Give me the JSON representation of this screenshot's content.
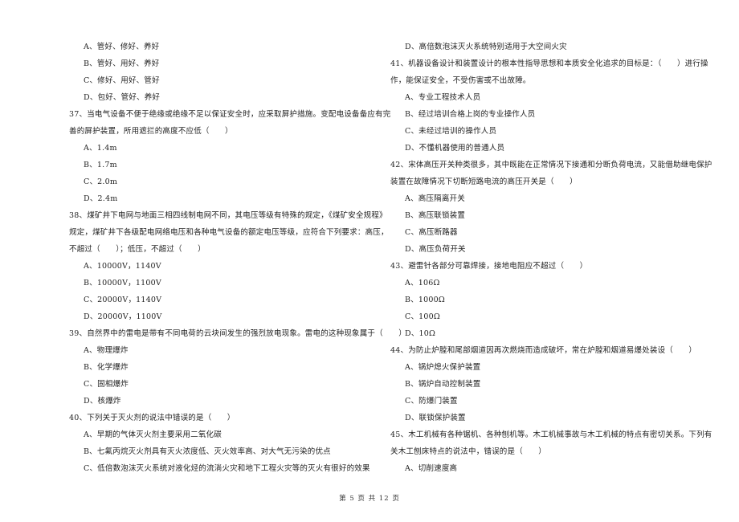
{
  "left_column": {
    "q36_options": [
      "A、管好、修好、养好",
      "B、管好、用好、养好",
      "C、修好、用好、管好",
      "D、包好、管好、养好"
    ],
    "q37": {
      "stem_lines": [
        "37、当电气设备不便于绝缘或绝缘不足以保证安全时，应采取屏护措施。变配电设备备应有完",
        "善的屏护装置，所用遮拦的高度不应低（　　）"
      ],
      "options": [
        "A、1.4m",
        "B、1.7m",
        "C、2.0m",
        "D、2.4m"
      ]
    },
    "q38": {
      "stem_lines": [
        "38、煤矿井下电网与地面三相四线制电网不同，其电压等级有特殊的规定，《煤矿安全规程》",
        "规定，煤矿井下各级配电网络电压和各种电气设备的额定电压等级，应符合下列要求：高压，",
        "不超过（　　）；低压，不超过（　　）"
      ],
      "options": [
        "A、10000V，1140V",
        "B、10000V，1100V",
        "C、20000V，1140V",
        "D、20000V，1100V"
      ]
    },
    "q39": {
      "stem_lines": [
        "39、自然界中的雷电是带有不同电荷的云块间发生的强烈放电现象。雷电的这种现象属于（　　）"
      ],
      "options": [
        "A、物理爆炸",
        "B、化学爆炸",
        "C、固相爆炸",
        "D、核爆炸"
      ]
    },
    "q40": {
      "stem_lines": [
        "40、下列关于灭火剂的说法中错误的是（　　）"
      ],
      "options": [
        "A、早期的气体灭火剂主要采用二氧化碳",
        "B、七氟丙烷灭火剂具有灭火浓度低、灭火效率高、对大气无污染的优点",
        "C、低倍数泡沫灭火系统对液化烃的流淌火灾和地下工程火灾等的灭火有很好的效果"
      ]
    }
  },
  "right_column": {
    "q40_option_d": "D、高倍数泡沫灭火系统特别适用于大空间火灾",
    "q41": {
      "stem_lines": [
        "41、机器设备设计和装置设计的根本性指导思想和本质安全化追求的目标是：（　　）进行操",
        "作，能保证安全，不受伤害或不出故障。"
      ],
      "options": [
        "A、专业工程技术人员",
        "B、经过培训合格上岗的专业操作人员",
        "C、未经过培训的操作人员",
        "D、不懂机器使用的普通人员"
      ]
    },
    "q42": {
      "stem_lines": [
        "42、宋体高压开关种类很多，其中既能在正常情况下接通和分断负荷电流，又能借助继电保护",
        "装置在故障情况下切断短路电流的高压开关是（　　）"
      ],
      "options": [
        "A、高压隔离开关",
        "B、高压联锁装置",
        "C、高压断路器",
        "D、高压负荷开关"
      ]
    },
    "q43": {
      "stem_lines": [
        "43、避雷针各部分可靠焊接，接地电阻应不超过（　　）"
      ],
      "options": [
        "A、106Ω",
        "B、1000Ω",
        "C、100Ω",
        "D、10Ω"
      ]
    },
    "q44": {
      "stem_lines": [
        "44、为防止炉膛和尾部烟道因再次燃烧而造成破坏，常在炉膛和烟道易爆处装设（　　）"
      ],
      "options": [
        "A、锅炉熄火保护装置",
        "B、锅炉自动控制装置",
        "C、防爆门装置",
        "D、联锁保护装置"
      ]
    },
    "q45": {
      "stem_lines": [
        "45、木工机械有各种锯机、各种刨机等。木工机械事故与木工机械的特点有密切关系。下列有",
        "关木工刨床特点的说法中，错误的是（　　）"
      ],
      "options": [
        "A、切削速度高"
      ]
    }
  },
  "footer": {
    "page_label": "第 5 页 共 12 页"
  }
}
